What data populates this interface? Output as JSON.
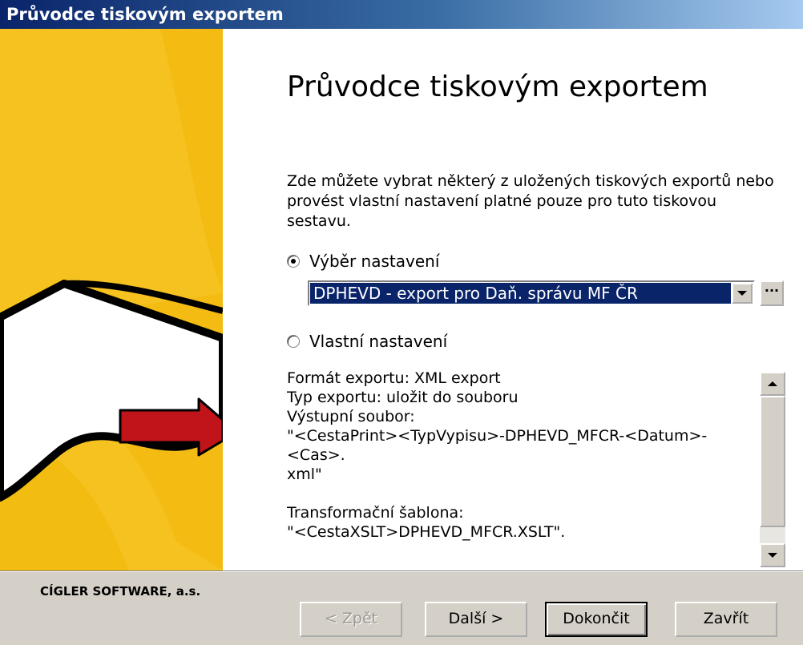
{
  "window": {
    "title": "Průvodce tiskovým exportem"
  },
  "main": {
    "heading": "Průvodce tiskovým exportem",
    "description": "Zde můžete vybrat některý z uložených tiskových exportů nebo provést vlastní nastavení platné pouze pro tuto tiskovou sestavu.",
    "radio_preset": {
      "label": "Výběr nastavení",
      "checked": true
    },
    "preset_combo": {
      "value": "DPHEVD - export pro Daň. správu MF ČR"
    },
    "browse_button": {
      "label": "···"
    },
    "radio_custom": {
      "label": "Vlastní nastavení",
      "checked": false
    },
    "info_lines": [
      "Formát exportu: XML export",
      "Typ exportu: uložit do souboru",
      "Výstupní soubor:",
      "\"<CestaPrint><TypVypisu>-DPHEVD_MFCR-<Datum>-<Cas>.",
      "xml\"",
      "",
      "Transformační šablona:",
      "\"<CestaXSLT>DPHEVD_MFCR.XSLT\"."
    ]
  },
  "footer": {
    "company": "CÍGLER SOFTWARE, a.s.",
    "buttons": {
      "back": "< Zpět",
      "next": "Další >",
      "finish": "Dokončit",
      "close": "Zavřít"
    }
  },
  "colors": {
    "banner_yellow": "#f6c21f",
    "selection_blue": "#0a246a",
    "arrow_red": "#c0141a",
    "button_face": "#d4d0c8"
  },
  "icons": {
    "illustration": "paper-sheet-with-red-arrow",
    "combo_dropdown": "triangle-down-icon",
    "scroll_up": "triangle-up-icon",
    "scroll_down": "triangle-down-icon"
  }
}
